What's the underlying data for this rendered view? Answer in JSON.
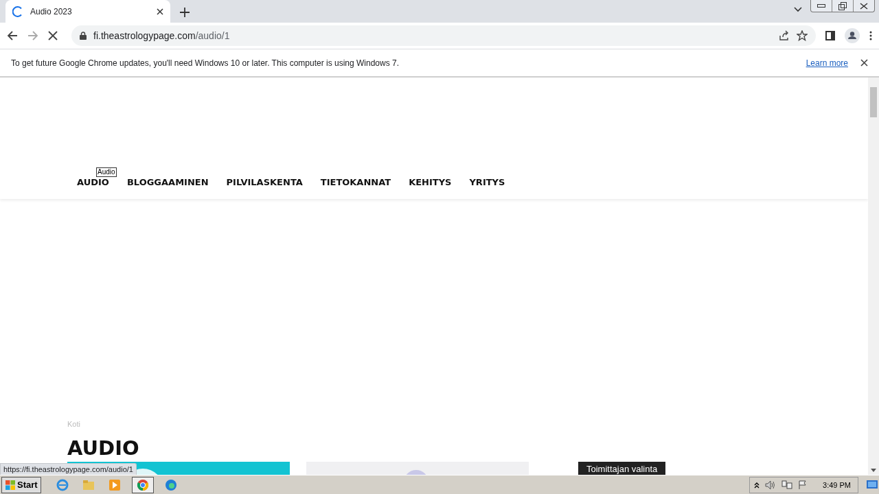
{
  "browser": {
    "tab_title": "Audio 2023",
    "url_host": "fi.theastrologypage.com",
    "url_path": "/audio/1"
  },
  "infobar": {
    "message": "To get future Google Chrome updates, you'll need Windows 10 or later. This computer is using Windows 7.",
    "link": "Learn more"
  },
  "nav": {
    "items": [
      "AUDIO",
      "BLOGGAAMINEN",
      "PILVILASKENTA",
      "TIETOKANNAT",
      "KEHITYS",
      "YRITYS"
    ],
    "tooltip": "Audio"
  },
  "breadcrumb": "Koti",
  "heading": "AUDIO",
  "cards": [
    {
      "kind": "picture"
    },
    {
      "kind": "picture"
    },
    {
      "kind": "label",
      "label": "Toimittajan valinta"
    }
  ],
  "status_url": "https://fi.theastrologypage.com/audio/1",
  "taskbar": {
    "start": "Start",
    "clock": "3:49 PM"
  }
}
